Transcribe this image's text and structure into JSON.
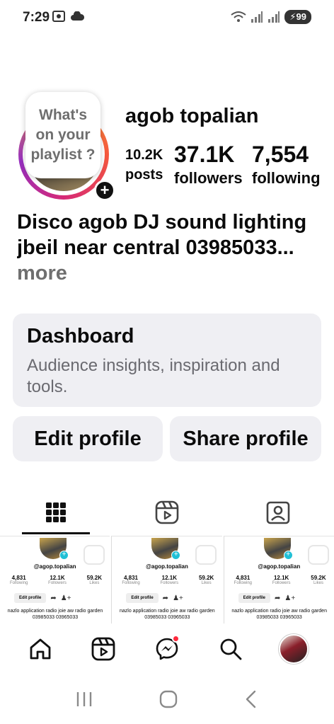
{
  "status_bar": {
    "time": "7:29",
    "battery": "99"
  },
  "profile": {
    "note": "What's on your playlist ?",
    "name": "agob topalian",
    "stats": {
      "posts_value": "10.2K",
      "posts_label": "posts",
      "followers_value": "37.1K",
      "followers_label": "followers",
      "following_value": "7,554",
      "following_label": "following"
    },
    "bio_line1": "Disco agob DJ sound lighting",
    "bio_line2": "jbeil near central 03985033...",
    "bio_more": "more"
  },
  "dashboard": {
    "title": "Dashboard",
    "subtitle": "Audience insights, inspiration and tools."
  },
  "actions": {
    "edit_profile": "Edit profile",
    "share_profile": "Share profile"
  },
  "tabs": [
    "grid-icon",
    "reels-icon",
    "tagged-icon"
  ],
  "posts": [
    {
      "handle": "@agop.topalian",
      "following": "4,831",
      "following_label": "Following",
      "followers": "12.1K",
      "followers_label": "Followers",
      "likes": "59.2K",
      "likes_label": "Likes",
      "edit": "Edit profile",
      "bio": "nazlo application radio joie aw radio garden 03985033 03965033"
    },
    {
      "handle": "@agop.topalian",
      "following": "4,831",
      "following_label": "Following",
      "followers": "12.1K",
      "followers_label": "Followers",
      "likes": "59.2K",
      "likes_label": "Likes",
      "edit": "Edit profile",
      "bio": "nazlo application radio joie aw radio garden 03985033 03965033"
    },
    {
      "handle": "@agop.topalian",
      "following": "4,831",
      "following_label": "Following",
      "followers": "12.1K",
      "followers_label": "Followers",
      "likes": "59.2K",
      "likes_label": "Likes",
      "edit": "Edit profile",
      "bio": "nazlo application radio joie aw radio garden 03985033 03965033"
    }
  ],
  "bottom_nav": [
    "home-icon",
    "reels-icon",
    "messenger-icon",
    "search-icon",
    "profile-avatar"
  ],
  "colors": {
    "accent_ring_start": "#f9a13a",
    "accent_ring_end": "#962fbf",
    "button_bg": "#efeff3",
    "notification_dot": "#ff2a3d"
  }
}
